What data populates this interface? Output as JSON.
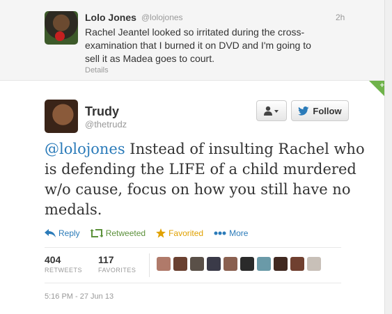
{
  "parent_tweet": {
    "name": "Lolo Jones",
    "handle": "@lolojones",
    "time": "2h",
    "text": "Rachel Jeantel looked so irritated during the cross-examination that I burned it on DVD and I'm going to sell it as Madea goes to court.",
    "details_label": "Details"
  },
  "tweet": {
    "name": "Trudy",
    "handle": "@thetrudz",
    "mention": "@lolojones",
    "text": " Instead of insulting Rachel who is defending the LIFE of a child murdered w/o cause, focus on how you still have no medals.",
    "follow_label": "Follow",
    "user_menu_icon": "user-dropdown-icon"
  },
  "actions": {
    "reply": "Reply",
    "retweeted": "Retweeted",
    "favorited": "Favorited",
    "more": "More"
  },
  "stats": {
    "retweets_count": "404",
    "retweets_label": "RETWEETS",
    "favorites_count": "117",
    "favorites_label": "FAVORITES"
  },
  "favoriters": [
    {
      "color": "#b07a6a"
    },
    {
      "color": "#6a4030"
    },
    {
      "color": "#5a5048"
    },
    {
      "color": "#3a3a48"
    },
    {
      "color": "#8a6050"
    },
    {
      "color": "#2a2a2a"
    },
    {
      "color": "#6a9aa8"
    },
    {
      "color": "#402820"
    },
    {
      "color": "#704030"
    },
    {
      "color": "#c8c0b8"
    }
  ],
  "timestamp": "5:16 PM - 27 Jun 13",
  "colors": {
    "link": "#2b7bb9",
    "retweet": "#5c913b",
    "favorite": "#e0a100"
  }
}
